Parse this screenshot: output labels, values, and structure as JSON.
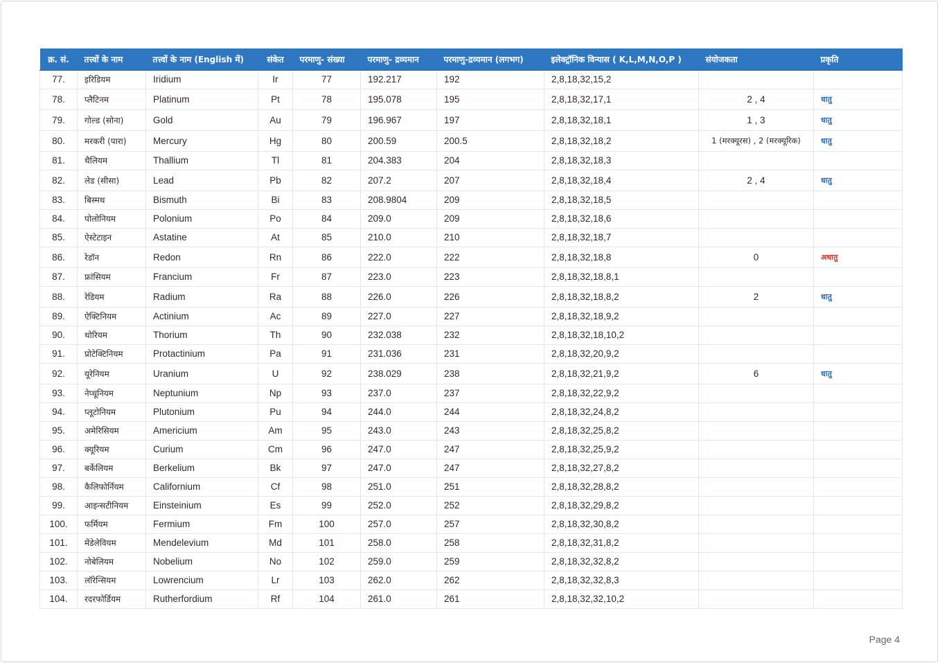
{
  "colors": {
    "header_bg": "#2f77c1",
    "metal": "#2f6cb3",
    "nonmetal": "#d9342b"
  },
  "headers": [
    "क्र. सं.",
    "तत्त्वों के नाम",
    "तत्त्वों के नाम (English में)",
    "संकेत",
    "परमाणु- संख्या",
    "परमाणु- द्रव्यमान",
    "परमाणु-द्रव्यमान (लगभग)",
    "इलेक्ट्रॉनिक विन्यास ( K,L,M,N,O,P )",
    "संयोजकता",
    "प्रकृति"
  ],
  "rows": [
    {
      "sn": "77.",
      "hi": "इरिडियम",
      "en": "Iridium",
      "sym": "Ir",
      "num": "77",
      "mass": "192.217",
      "approx": "192",
      "config": "2,8,18,32,15,2",
      "val": "",
      "nat": ""
    },
    {
      "sn": "78.",
      "hi": "प्लैटिनम",
      "en": "Platinum",
      "sym": "Pt",
      "num": "78",
      "mass": "195.078",
      "approx": "195",
      "config": "2,8,18,32,17,1",
      "val": "2 , 4",
      "nat": "धातु"
    },
    {
      "sn": "79.",
      "hi": "गोल्ड (सोना)",
      "en": "Gold",
      "sym": "Au",
      "num": "79",
      "mass": "196.967",
      "approx": "197",
      "config": "2,8,18,32,18,1",
      "val": "1 , 3",
      "nat": "धातु"
    },
    {
      "sn": "80.",
      "hi": "मरकरी (पारा)",
      "en": "Mercury",
      "sym": "Hg",
      "num": "80",
      "mass": "200.59",
      "approx": "200.5",
      "config": "2,8,18,32,18,2",
      "val": "1 (मरक्यूरस) , 2 (मरक्यूरिक)",
      "nat": "धातु"
    },
    {
      "sn": "81.",
      "hi": "थैलियम",
      "en": "Thallium",
      "sym": "Tl",
      "num": "81",
      "mass": "204.383",
      "approx": "204",
      "config": "2,8,18,32,18,3",
      "val": "",
      "nat": ""
    },
    {
      "sn": "82.",
      "hi": "लेड (सीसा)",
      "en": "Lead",
      "sym": "Pb",
      "num": "82",
      "mass": "207.2",
      "approx": "207",
      "config": "2,8,18,32,18,4",
      "val": "2 , 4",
      "nat": "धातु"
    },
    {
      "sn": "83.",
      "hi": "बिस्मथ",
      "en": "Bismuth",
      "sym": "Bi",
      "num": "83",
      "mass": "208.9804",
      "approx": "209",
      "config": "2,8,18,32,18,5",
      "val": "",
      "nat": ""
    },
    {
      "sn": "84.",
      "hi": "पोलोनियम",
      "en": "Polonium",
      "sym": "Po",
      "num": "84",
      "mass": "209.0",
      "approx": "209",
      "config": "2,8,18,32,18,6",
      "val": "",
      "nat": ""
    },
    {
      "sn": "85.",
      "hi": "ऐस्टेटाइन",
      "en": "Astatine",
      "sym": "At",
      "num": "85",
      "mass": "210.0",
      "approx": "210",
      "config": "2,8,18,32,18,7",
      "val": "",
      "nat": ""
    },
    {
      "sn": "86.",
      "hi": "रेडॉन",
      "en": "Redon",
      "sym": "Rn",
      "num": "86",
      "mass": "222.0",
      "approx": "222",
      "config": "2,8,18,32,18,8",
      "val": "0",
      "nat": "अधातु"
    },
    {
      "sn": "87.",
      "hi": "फ्रांसियम",
      "en": "Francium",
      "sym": "Fr",
      "num": "87",
      "mass": "223.0",
      "approx": "223",
      "config": "2,8,18,32,18,8,1",
      "val": "",
      "nat": ""
    },
    {
      "sn": "88.",
      "hi": "रेडियम",
      "en": "Radium",
      "sym": "Ra",
      "num": "88",
      "mass": "226.0",
      "approx": "226",
      "config": "2,8,18,32,18,8,2",
      "val": "2",
      "nat": "धातु"
    },
    {
      "sn": "89.",
      "hi": "ऐक्टिनियम",
      "en": "Actinium",
      "sym": "Ac",
      "num": "89",
      "mass": "227.0",
      "approx": "227",
      "config": "2,8,18,32,18,9,2",
      "val": "",
      "nat": ""
    },
    {
      "sn": "90.",
      "hi": "थोरियम",
      "en": "Thorium",
      "sym": "Th",
      "num": "90",
      "mass": "232.038",
      "approx": "232",
      "config": "2,8,18,32,18,10,2",
      "val": "",
      "nat": ""
    },
    {
      "sn": "91.",
      "hi": "प्रोटेक्टिनियम",
      "en": "Protactinium",
      "sym": "Pa",
      "num": "91",
      "mass": "231.036",
      "approx": "231",
      "config": "2,8,18,32,20,9,2",
      "val": "",
      "nat": ""
    },
    {
      "sn": "92.",
      "hi": "यूरेनियम",
      "en": "Uranium",
      "sym": "U",
      "num": "92",
      "mass": "238.029",
      "approx": "238",
      "config": "2,8,18,32,21,9,2",
      "val": "6",
      "nat": "धातु"
    },
    {
      "sn": "93.",
      "hi": "नेप्चूनियम",
      "en": "Neptunium",
      "sym": "Np",
      "num": "93",
      "mass": "237.0",
      "approx": "237",
      "config": "2,8,18,32,22,9,2",
      "val": "",
      "nat": ""
    },
    {
      "sn": "94.",
      "hi": "प्लूटोनियम",
      "en": "Plutonium",
      "sym": "Pu",
      "num": "94",
      "mass": "244.0",
      "approx": "244",
      "config": "2,8,18,32,24,8,2",
      "val": "",
      "nat": ""
    },
    {
      "sn": "95.",
      "hi": "अमेरिसियम",
      "en": "Americium",
      "sym": "Am",
      "num": "95",
      "mass": "243.0",
      "approx": "243",
      "config": "2,8,18,32,25,8,2",
      "val": "",
      "nat": ""
    },
    {
      "sn": "96.",
      "hi": "क्यूरियम",
      "en": "Curium",
      "sym": "Cm",
      "num": "96",
      "mass": "247.0",
      "approx": "247",
      "config": "2,8,18,32,25,9,2",
      "val": "",
      "nat": ""
    },
    {
      "sn": "97.",
      "hi": "बर्केलियम",
      "en": "Berkelium",
      "sym": "Bk",
      "num": "97",
      "mass": "247.0",
      "approx": "247",
      "config": "2,8,18,32,27,8,2",
      "val": "",
      "nat": ""
    },
    {
      "sn": "98.",
      "hi": "कैलिफोर्नियम",
      "en": "Californium",
      "sym": "Cf",
      "num": "98",
      "mass": "251.0",
      "approx": "251",
      "config": "2,8,18,32,28,8,2",
      "val": "",
      "nat": ""
    },
    {
      "sn": "99.",
      "hi": "आइन्सटीनियम",
      "en": "Einsteinium",
      "sym": "Es",
      "num": "99",
      "mass": "252.0",
      "approx": "252",
      "config": "2,8,18,32,29,8,2",
      "val": "",
      "nat": ""
    },
    {
      "sn": "100.",
      "hi": "फर्मियम",
      "en": "Fermium",
      "sym": "Fm",
      "num": "100",
      "mass": "257.0",
      "approx": "257",
      "config": "2,8,18,32,30,8,2",
      "val": "",
      "nat": ""
    },
    {
      "sn": "101.",
      "hi": "मेंडेलेवियम",
      "en": "Mendelevium",
      "sym": "Md",
      "num": "101",
      "mass": "258.0",
      "approx": "258",
      "config": "2,8,18,32,31,8,2",
      "val": "",
      "nat": ""
    },
    {
      "sn": "102.",
      "hi": "नोबेलियम",
      "en": "Nobelium",
      "sym": "No",
      "num": "102",
      "mass": "259.0",
      "approx": "259",
      "config": "2,8,18,32,32,8,2",
      "val": "",
      "nat": ""
    },
    {
      "sn": "103.",
      "hi": "लॉरेन्सियम",
      "en": "Lowrencium",
      "sym": "Lr",
      "num": "103",
      "mass": "262.0",
      "approx": "262",
      "config": "2,8,18,32,32,8,3",
      "val": "",
      "nat": ""
    },
    {
      "sn": "104.",
      "hi": "रदरफोर्डियम",
      "en": "Rutherfordium",
      "sym": "Rf",
      "num": "104",
      "mass": "261.0",
      "approx": "261",
      "config": "2,8,18,32,32,10,2",
      "val": "",
      "nat": ""
    }
  ],
  "footer": {
    "page": "Page 4"
  }
}
